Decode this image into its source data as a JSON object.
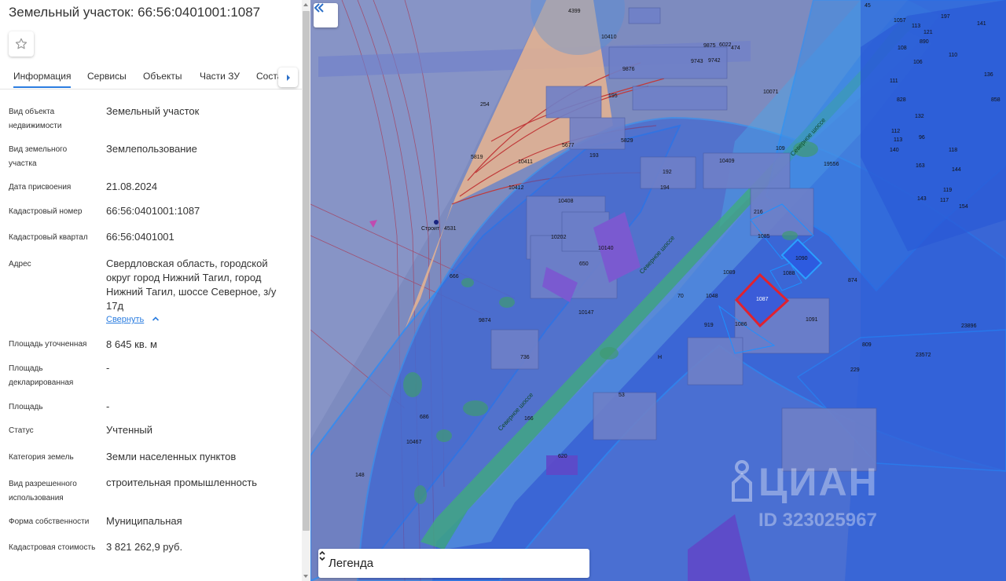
{
  "title": "Земельный участок: 66:56:0401001:1087",
  "tabs": [
    "Информация",
    "Сервисы",
    "Объекты",
    "Части ЗУ",
    "Состав"
  ],
  "rows": [
    {
      "label": "Вид объекта недвижимости",
      "value": "Земельный участок"
    },
    {
      "label": "Вид земельного участка",
      "value": "Землепользование"
    },
    {
      "label": "Дата присвоения",
      "value": "21.08.2024"
    },
    {
      "label": "Кадастровый номер",
      "value": "66:56:0401001:1087"
    },
    {
      "label": "Кадастровый квартал",
      "value": "66:56:0401001"
    },
    {
      "label": "Адрес",
      "value": "Свердловская область, городской округ город Нижний Тагил, город Нижний Тагил, шоссе Северное, з/у 17д"
    },
    {
      "label": "Площадь уточненная",
      "value": "8 645 кв. м"
    },
    {
      "label": "Площадь декларированная",
      "value": "-"
    },
    {
      "label": "Площадь",
      "value": "-"
    },
    {
      "label": "Статус",
      "value": "Учтенный"
    },
    {
      "label": "Категория земель",
      "value": "Земли населенных пунктов"
    },
    {
      "label": "Вид разрешенного использования",
      "value": "строительная промышленность"
    },
    {
      "label": "Форма собственности",
      "value": "Муниципальная"
    },
    {
      "label": "Кадастровая стоимость",
      "value": "3 821 262,9 руб."
    }
  ],
  "collapse_link": "Свернуть",
  "legend": {
    "label": "Легенда"
  },
  "watermark": {
    "brand": "ЦИАН",
    "id": "ID 323025967"
  },
  "map": {
    "selected_parcel": "1087",
    "road_labels": [
      "Северное шоссе",
      "Северное шоссе",
      "Северное шоссе"
    ],
    "building_labels": [
      "4399",
      "10410",
      "9875",
      "6022",
      "474",
      "9743",
      "9742",
      "9876",
      "10071",
      "195",
      "254",
      "5677",
      "193",
      "5819",
      "5829",
      "10411",
      "192",
      "194",
      "10409",
      "10412",
      "10408",
      "19556",
      "109",
      "216",
      "1085",
      "1090",
      "1088",
      "1089",
      "1048",
      "70",
      "919",
      "1086",
      "1091",
      "874",
      "10202",
      "10140",
      "650",
      "666",
      "10147",
      "9874",
      "736",
      "53",
      "686",
      "10467",
      "166",
      "620",
      "148",
      "4531",
      "45",
      "1057",
      "113",
      "197",
      "141",
      "121",
      "890",
      "108",
      "106",
      "110",
      "136",
      "111",
      "828",
      "858",
      "112",
      "132",
      "113",
      "96",
      "118",
      "140",
      "163",
      "144",
      "119",
      "143",
      "117",
      "154",
      "809",
      "229",
      "23572",
      "23896"
    ],
    "other_labels": [
      "Строит",
      "Н"
    ]
  },
  "colors": {
    "accent": "#2b7de0",
    "selected_parcel_outline": "#e0222f",
    "zone_blue": "#2f5fd8",
    "zone_light": "#1e90ff",
    "green_strip": "#2ea86a",
    "peach_zone": "#f0b48a"
  },
  "icons": {
    "favorite": "star-outline-icon",
    "tabs_next": "chevron-right-icon",
    "collapse_link": "chevron-up-icon",
    "panel_toggle": "double-chevron-left-icon",
    "legend_select": "up-down-chevron-icon"
  }
}
